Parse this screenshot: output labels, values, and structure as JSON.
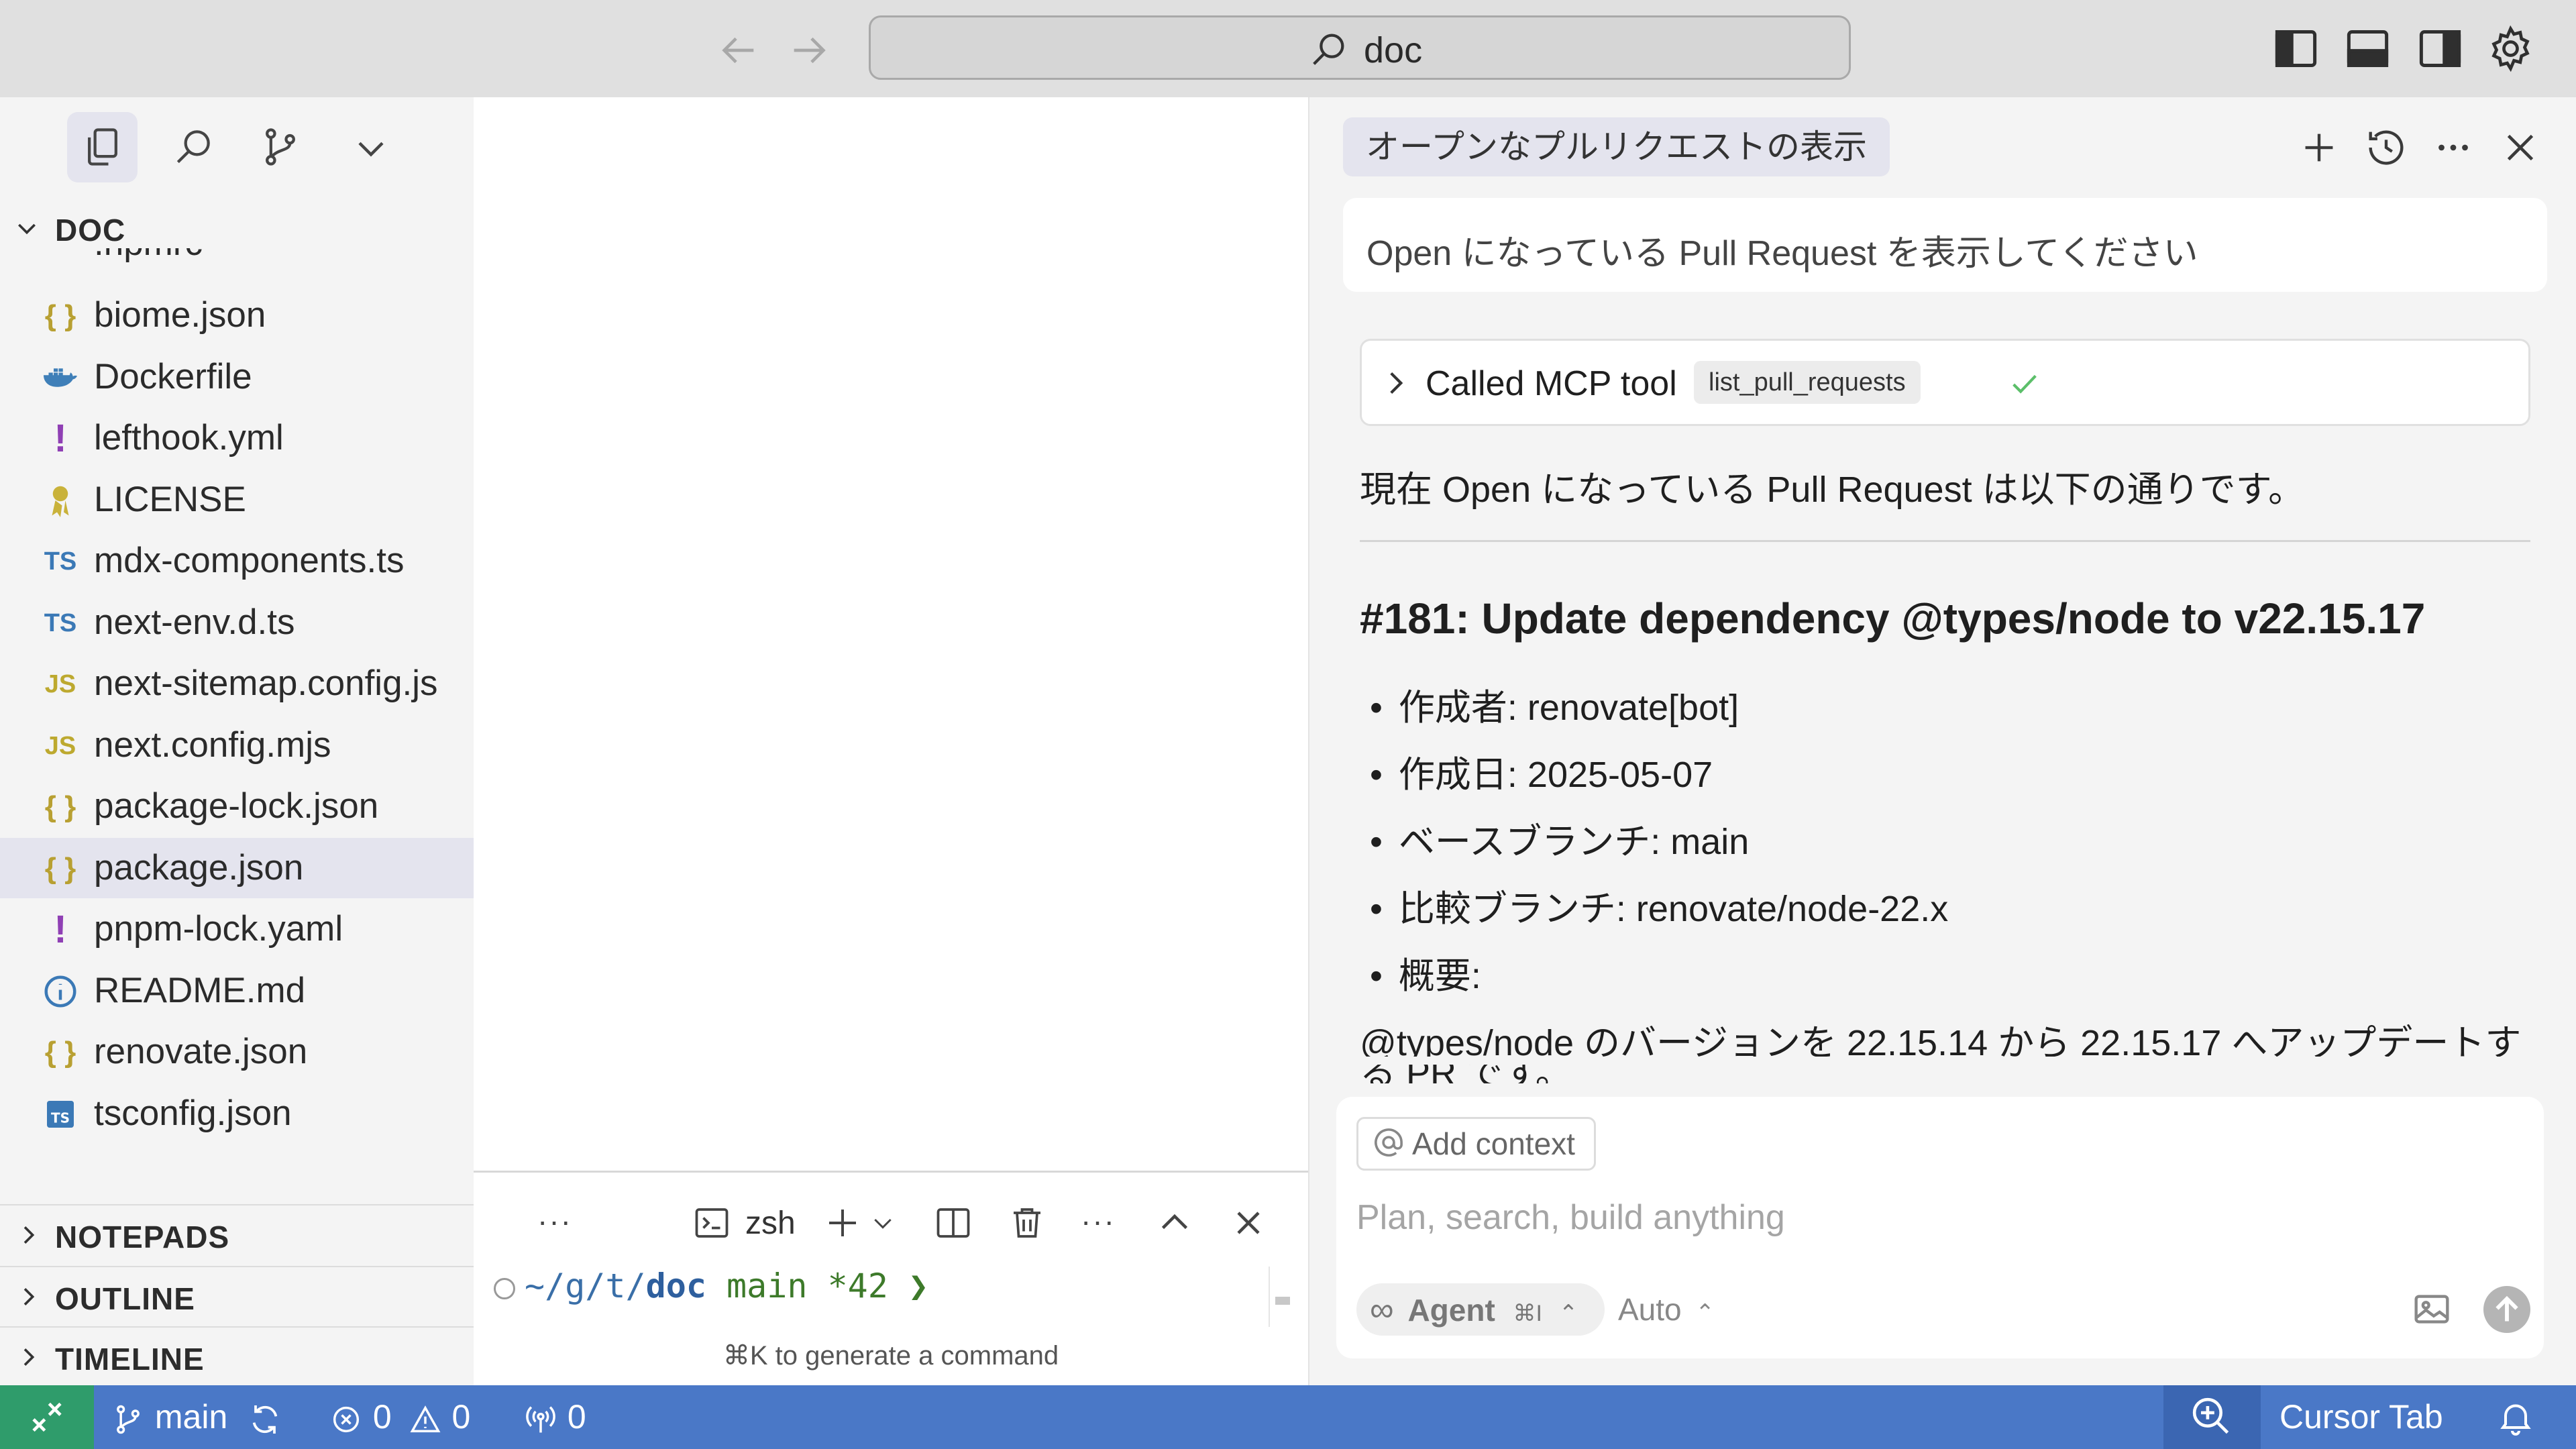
{
  "titlebar": {
    "search_text": "doc"
  },
  "sidebar": {
    "section_title": "DOC",
    "partial_item": ".npmrc",
    "files": [
      {
        "name": "biome.json",
        "icon": "{ }"
      },
      {
        "name": "Dockerfile",
        "icon": "docker"
      },
      {
        "name": "lefthook.yml",
        "icon": "!"
      },
      {
        "name": "LICENSE",
        "icon": "license"
      },
      {
        "name": "mdx-components.ts",
        "icon": "TS"
      },
      {
        "name": "next-env.d.ts",
        "icon": "TS"
      },
      {
        "name": "next-sitemap.config.js",
        "icon": "JS"
      },
      {
        "name": "next.config.mjs",
        "icon": "JS"
      },
      {
        "name": "package-lock.json",
        "icon": "{ }"
      },
      {
        "name": "package.json",
        "icon": "{ }"
      },
      {
        "name": "pnpm-lock.yaml",
        "icon": "!"
      },
      {
        "name": "README.md",
        "icon": "info"
      },
      {
        "name": "renovate.json",
        "icon": "{ }"
      },
      {
        "name": "tsconfig.json",
        "icon": "TS"
      }
    ],
    "selected_file": "package.json",
    "sections": [
      "NOTEPADS",
      "OUTLINE",
      "TIMELINE"
    ]
  },
  "terminal": {
    "more_label": "···",
    "shell_label": "zsh",
    "prompt_path_prefix": "~/g/t/",
    "prompt_dir": "doc",
    "prompt_branch": "main",
    "prompt_changes": "*42",
    "prompt_symbol": "❯",
    "hint": "⌘K to generate a command"
  },
  "chat": {
    "tab_title": "オープンなプルリクエストの表示",
    "user_message": "Open になっている Pull Request を表示してください",
    "tool_call_label": "Called MCP tool",
    "tool_name": "list_pull_requests",
    "intro": "現在 Open になっている Pull Request は以下の通りです。",
    "pr_title": "#181: Update dependency @types/node to v22.15.17",
    "pr_details": [
      "作成者: renovate[bot]",
      "作成日: 2025-05-07",
      "ベースブランチ: main",
      "比較ブランチ: renovate/node-22.x",
      "概要:"
    ],
    "summary": "@types/node のバージョンを 22.15.14 から 22.15.17 へアップデートす",
    "summary_cont": "る PR です。",
    "input": {
      "add_context": "Add context",
      "placeholder": "Plan, search, build anything",
      "agent_label": "Agent",
      "agent_shortcut": "⌘I",
      "model_label": "Auto"
    }
  },
  "statusbar": {
    "branch": "main",
    "errors": "0",
    "warnings": "0",
    "ports": "0",
    "cursor_tab": "Cursor Tab"
  },
  "colors": {
    "statusbar": "#4a78c7",
    "remote": "#2f9c6b",
    "selection": "#e4e4ee",
    "check": "#5cbf6a"
  }
}
